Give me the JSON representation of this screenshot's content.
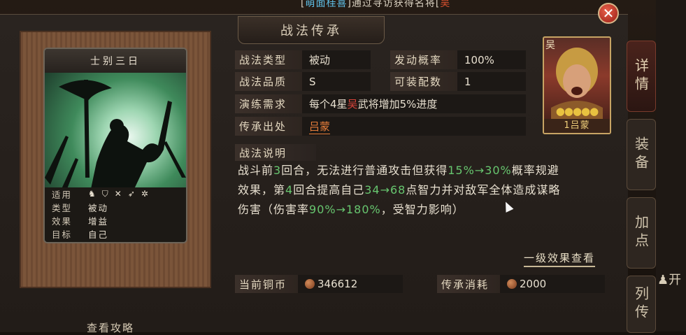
{
  "banner": {
    "pre": "[",
    "name": "萌面桂喜",
    "mid": "]通过寻访获得名将[",
    "tail": "吴"
  },
  "title": "战法传承",
  "close_label": "✕",
  "card": {
    "name": "士别三日",
    "rows": [
      {
        "key": "适用",
        "val": ""
      },
      {
        "key": "类型",
        "val": "被动"
      },
      {
        "key": "效果",
        "val": "增益"
      },
      {
        "key": "目标",
        "val": "自己"
      }
    ],
    "troop_icons": [
      "cavalry-icon",
      "shield-icon",
      "bow-icon",
      "spear-icon",
      "wheel-icon"
    ]
  },
  "attributes": {
    "type_label": "战法类型",
    "type_val": "被动",
    "prob_label": "发动概率",
    "prob_val": "100%",
    "quality_label": "战法品质",
    "quality_val": "S",
    "equip_label": "可装配数",
    "equip_val": "1",
    "train_label": "演练需求",
    "train_pre": "每个4星",
    "train_faction": "吴",
    "train_post": "武将增加5%进度",
    "origin_label": "传承出处",
    "origin_val": "吕蒙"
  },
  "general": {
    "faction": "吴",
    "stars": "●●●●●",
    "name": "1吕蒙"
  },
  "desc": {
    "label": "战法说明",
    "p1": "战斗前",
    "n1": "3",
    "p2": "回合，无法进行普通攻击但获得",
    "n2": "15%→30%",
    "p3": "概率规避",
    "p4": "效果，第",
    "n3": "4",
    "p5": "回合提高自己",
    "n4": "34→68",
    "p6": "点智力并对敌军全体造成谋略",
    "p7": "伤害（伤害率",
    "n5": "90%→180%",
    "p8": "，受智力影响）"
  },
  "effect_link": "一级效果查看",
  "coins": {
    "label": "当前铜币",
    "val": "346612"
  },
  "cost": {
    "label": "传承消耗",
    "val": "2000"
  },
  "side_tabs": [
    "详情",
    "装备",
    "加点",
    "列传"
  ],
  "right_glyph": "开",
  "guide": "查看攻略",
  "colors": {
    "accent": "#e67d3a",
    "green": "#67c66f",
    "faction": "#d9443a"
  }
}
